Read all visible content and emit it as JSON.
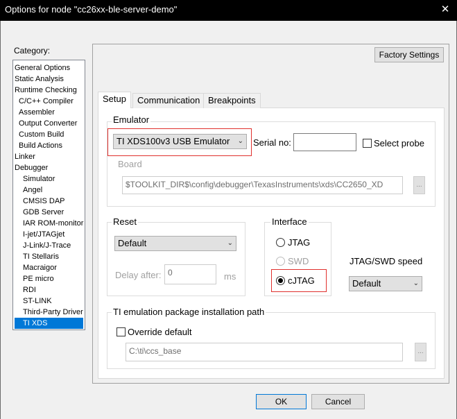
{
  "window": {
    "title": "Options for node \"cc26xx-ble-server-demo\"",
    "close_glyph": "✕"
  },
  "category": {
    "label": "Category:",
    "items": [
      "General Options",
      "Static Analysis",
      "Runtime Checking",
      "C/C++ Compiler",
      "Assembler",
      "Output Converter",
      "Custom Build",
      "Build Actions",
      "Linker",
      "Debugger",
      "Simulator",
      "Angel",
      "CMSIS DAP",
      "GDB Server",
      "IAR ROM-monitor",
      "I-jet/JTAGjet",
      "J-Link/J-Trace",
      "TI Stellaris",
      "Macraigor",
      "PE micro",
      "RDI",
      "ST-LINK",
      "Third-Party Driver",
      "TI XDS"
    ],
    "selected": "TI XDS"
  },
  "factory_settings_label": "Factory Settings",
  "tabs": [
    {
      "label": "Setup",
      "active": true
    },
    {
      "label": "Communication",
      "active": false
    },
    {
      "label": "Breakpoints",
      "active": false
    }
  ],
  "emulator": {
    "group_label": "Emulator",
    "selected": "TI XDS100v3 USB Emulator",
    "serial_label": "Serial no:",
    "serial_value": "",
    "select_probe_label": "Select probe",
    "select_probe_checked": false,
    "board_label": "Board",
    "board_value": "$TOOLKIT_DIR$\\config\\debugger\\TexasInstruments\\xds\\CC2650_XD",
    "browse_label": "..."
  },
  "reset": {
    "group_label": "Reset",
    "selected": "Default",
    "delay_label": "Delay after:",
    "delay_value": "0",
    "delay_unit": "ms"
  },
  "interface": {
    "group_label": "Interface",
    "options": [
      {
        "label": "JTAG",
        "checked": false,
        "enabled": true
      },
      {
        "label": "SWD",
        "checked": false,
        "enabled": false
      },
      {
        "label": "cJTAG",
        "checked": true,
        "enabled": true
      }
    ]
  },
  "speed": {
    "label": "JTAG/SWD speed",
    "selected": "Default"
  },
  "ti_path": {
    "group_label": "TI emulation package installation path",
    "override_label": "Override default",
    "override_checked": false,
    "path_value": "C:\\ti\\ccs_base",
    "browse_label": "..."
  },
  "buttons": {
    "ok": "OK",
    "cancel": "Cancel"
  },
  "colors": {
    "selection": "#0078d7",
    "highlight": "#e0302d",
    "dialog_bg": "#f0f0f0"
  }
}
